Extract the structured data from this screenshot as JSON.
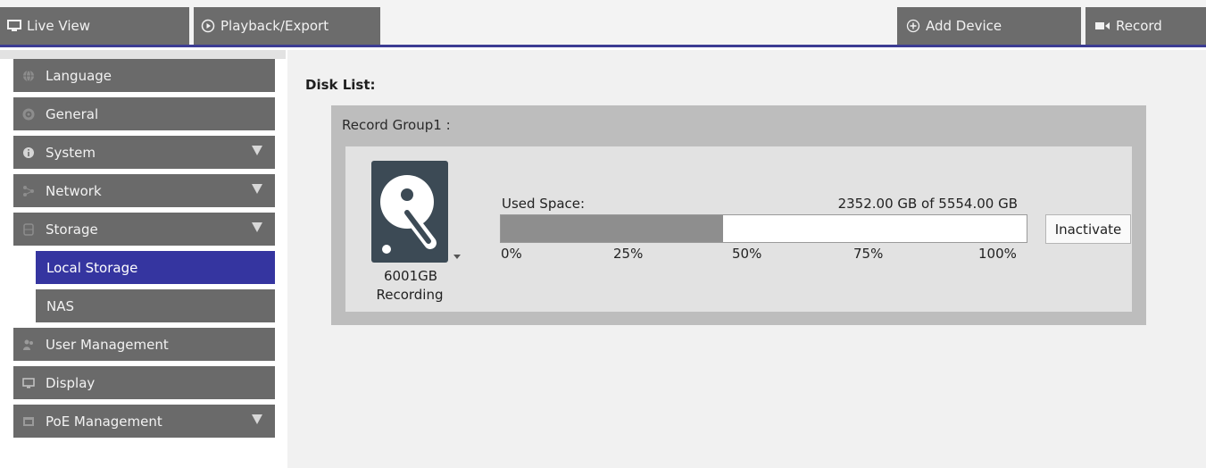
{
  "topnav": {
    "live_view": "Live View",
    "playback_export": "Playback/Export",
    "add_device": "Add Device",
    "record": "Record"
  },
  "sidebar": {
    "items": [
      {
        "label": "Language",
        "icon": "globe-icon",
        "expandable": false
      },
      {
        "label": "General",
        "icon": "gear-icon",
        "expandable": false
      },
      {
        "label": "System",
        "icon": "info-icon",
        "expandable": true
      },
      {
        "label": "Network",
        "icon": "network-icon",
        "expandable": true
      },
      {
        "label": "Storage",
        "icon": "database-icon",
        "expandable": true
      },
      {
        "label": "Local Storage",
        "sub": true,
        "active": true
      },
      {
        "label": "NAS",
        "sub": true
      },
      {
        "label": "User Management",
        "icon": "users-icon",
        "expandable": false
      },
      {
        "label": "Display",
        "icon": "monitor-icon",
        "expandable": false
      },
      {
        "label": "PoE Management",
        "icon": "poe-icon",
        "expandable": true
      }
    ]
  },
  "main": {
    "disk_list_title": "Disk List:",
    "record_group_label": "Record Group1 :",
    "disk": {
      "size": "6001GB",
      "status": "Recording",
      "icon": "hard-disk-icon"
    },
    "used_space_label": "Used Space:",
    "used_space_value": "2352.00 GB of 5554.00 GB",
    "used_fraction": 0.4235,
    "ticks": [
      "0%",
      "25%",
      "50%",
      "75%",
      "100%"
    ],
    "inactivate_button": "Inactivate"
  },
  "colors": {
    "accent": "#3535a0",
    "nav_bg": "#6a6a6a",
    "bar_fill": "#8e8e8e"
  }
}
